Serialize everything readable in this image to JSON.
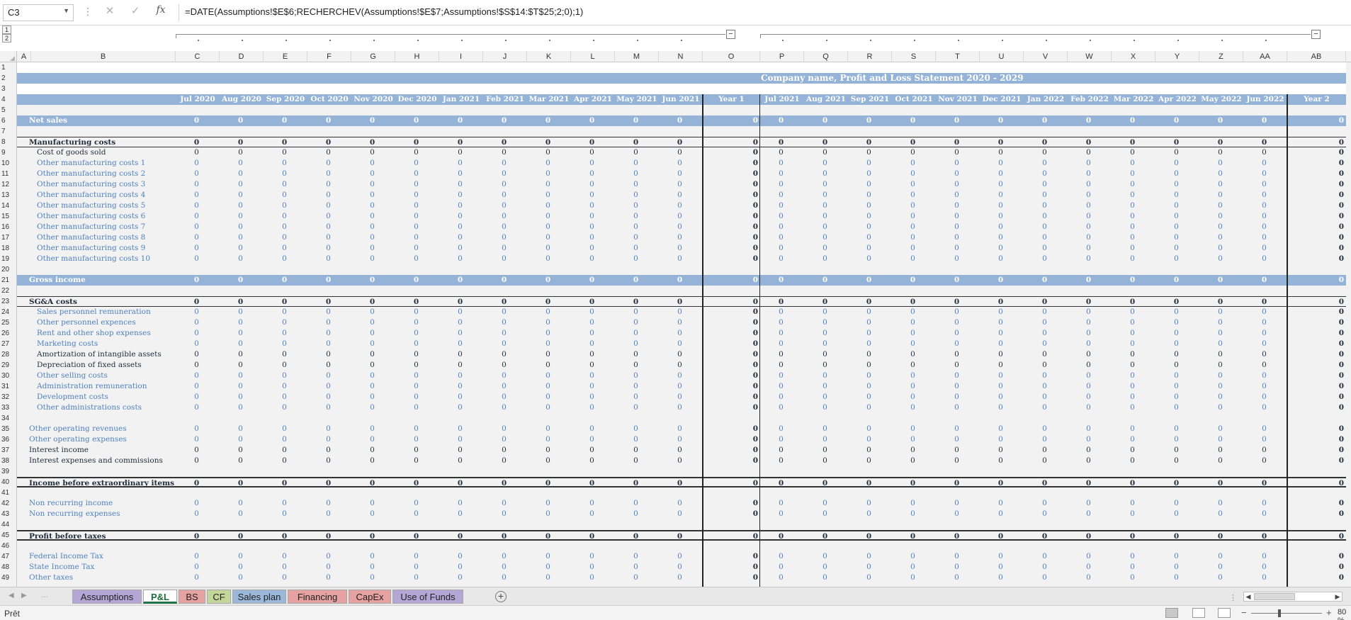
{
  "formula_bar": {
    "name_box": "C3",
    "formula": "=DATE(Assumptions!$E$6;RECHERCHEV(Assumptions!$E$7;Assumptions!$S$14:$T$25;2;0);1)"
  },
  "outline": {
    "levels": [
      "1",
      "2"
    ],
    "collapse_symbol": "−"
  },
  "columns": [
    "A",
    "B",
    "C",
    "D",
    "E",
    "F",
    "G",
    "H",
    "I",
    "J",
    "K",
    "L",
    "M",
    "N",
    "O",
    "P",
    "Q",
    "R",
    "S",
    "T",
    "U",
    "V",
    "W",
    "X",
    "Y",
    "Z",
    "AA",
    "AB"
  ],
  "sheet": {
    "title": "Company name, Profit and Loss Statement 2020 - 2029",
    "months_year1": [
      "Jul 2020",
      "Aug 2020",
      "Sep 2020",
      "Oct 2020",
      "Nov 2020",
      "Dec 2020",
      "Jan 2021",
      "Feb 2021",
      "Mar 2021",
      "Apr 2021",
      "May 2021",
      "Jun 2021"
    ],
    "year1_label": "Year 1",
    "months_year2": [
      "Jul 2021",
      "Aug 2021",
      "Sep 2021",
      "Oct 2021",
      "Nov 2021",
      "Dec 2021",
      "Jan 2022",
      "Feb 2022",
      "Mar 2022",
      "Apr 2022",
      "May 2022",
      "Jun 2022"
    ],
    "year2_label": "Year 2",
    "zero": "0",
    "rows": [
      {
        "n": "1",
        "type": "blank"
      },
      {
        "n": "2",
        "type": "title"
      },
      {
        "n": "3",
        "type": "blank"
      },
      {
        "n": "4",
        "type": "header"
      },
      {
        "n": "5",
        "type": "blank"
      },
      {
        "n": "6",
        "type": "band",
        "label": "Net sales"
      },
      {
        "n": "7",
        "type": "blank"
      },
      {
        "n": "8",
        "type": "section",
        "label": "Manufacturing costs"
      },
      {
        "n": "9",
        "type": "item",
        "style": "dark",
        "indent": true,
        "label": "Cost of goods sold"
      },
      {
        "n": "10",
        "type": "item",
        "style": "blue",
        "indent": true,
        "label": "Other manufacturing costs 1"
      },
      {
        "n": "11",
        "type": "item",
        "style": "blue",
        "indent": true,
        "label": "Other manufacturing costs 2"
      },
      {
        "n": "12",
        "type": "item",
        "style": "blue",
        "indent": true,
        "label": "Other manufacturing costs 3"
      },
      {
        "n": "13",
        "type": "item",
        "style": "blue",
        "indent": true,
        "label": "Other manufacturing costs 4"
      },
      {
        "n": "14",
        "type": "item",
        "style": "blue",
        "indent": true,
        "label": "Other manufacturing costs 5"
      },
      {
        "n": "15",
        "type": "item",
        "style": "blue",
        "indent": true,
        "label": "Other manufacturing costs 6"
      },
      {
        "n": "16",
        "type": "item",
        "style": "blue",
        "indent": true,
        "label": "Other manufacturing costs 7"
      },
      {
        "n": "17",
        "type": "item",
        "style": "blue",
        "indent": true,
        "label": "Other manufacturing costs 8"
      },
      {
        "n": "18",
        "type": "item",
        "style": "blue",
        "indent": true,
        "label": "Other manufacturing costs 9"
      },
      {
        "n": "19",
        "type": "item",
        "style": "blue",
        "indent": true,
        "label": "Other manufacturing costs 10"
      },
      {
        "n": "20",
        "type": "blank"
      },
      {
        "n": "21",
        "type": "band",
        "label": "Gross income"
      },
      {
        "n": "22",
        "type": "blank"
      },
      {
        "n": "23",
        "type": "section",
        "label": "SG&A costs"
      },
      {
        "n": "24",
        "type": "item",
        "style": "blue",
        "indent": true,
        "label": "Sales personnel remuneration"
      },
      {
        "n": "25",
        "type": "item",
        "style": "blue",
        "indent": true,
        "label": "Other personnel expences"
      },
      {
        "n": "26",
        "type": "item",
        "style": "blue",
        "indent": true,
        "label": "Rent and other shop expenses"
      },
      {
        "n": "27",
        "type": "item",
        "style": "blue",
        "indent": true,
        "label": "Marketing costs"
      },
      {
        "n": "28",
        "type": "item",
        "style": "dark",
        "indent": true,
        "label": "Amortization of intangible assets"
      },
      {
        "n": "29",
        "type": "item",
        "style": "dark",
        "indent": true,
        "label": "Depreciation of fixed assets"
      },
      {
        "n": "30",
        "type": "item",
        "style": "blue",
        "indent": true,
        "label": "Other selling costs"
      },
      {
        "n": "31",
        "type": "item",
        "style": "blue",
        "indent": true,
        "label": "Administration remuneration"
      },
      {
        "n": "32",
        "type": "item",
        "style": "blue",
        "indent": true,
        "label": "Development costs"
      },
      {
        "n": "33",
        "type": "item",
        "style": "blue",
        "indent": true,
        "label": "Other administrations costs"
      },
      {
        "n": "34",
        "type": "blank"
      },
      {
        "n": "35",
        "type": "item",
        "style": "blue",
        "indent": false,
        "label": "Other operating revenues"
      },
      {
        "n": "36",
        "type": "item",
        "style": "blue",
        "indent": false,
        "label": "Other operating expenses"
      },
      {
        "n": "37",
        "type": "item",
        "style": "dark",
        "indent": false,
        "label": "Interest income"
      },
      {
        "n": "38",
        "type": "item",
        "style": "dark",
        "indent": false,
        "label": "Interest expenses and commissions"
      },
      {
        "n": "39",
        "type": "blank"
      },
      {
        "n": "40",
        "type": "section2",
        "label": "Income before extraordinary items"
      },
      {
        "n": "41",
        "type": "blank"
      },
      {
        "n": "42",
        "type": "item",
        "style": "blue",
        "indent": false,
        "label": "Non recurring income"
      },
      {
        "n": "43",
        "type": "item",
        "style": "blue",
        "indent": false,
        "label": "Non recurring expenses"
      },
      {
        "n": "44",
        "type": "blank"
      },
      {
        "n": "45",
        "type": "section2",
        "label": "Profit before taxes"
      },
      {
        "n": "46",
        "type": "blank"
      },
      {
        "n": "47",
        "type": "item",
        "style": "blue",
        "indent": false,
        "label": "Federal Income Tax"
      },
      {
        "n": "48",
        "type": "item",
        "style": "blue",
        "indent": false,
        "label": "State Income Tax"
      },
      {
        "n": "49",
        "type": "item",
        "style": "blue",
        "indent": false,
        "label": "Other taxes"
      }
    ]
  },
  "tabs": [
    {
      "label": "Assumptions",
      "color": "#b4a7d6"
    },
    {
      "label": "P&L",
      "color": "#ffffff",
      "active": true
    },
    {
      "label": "BS",
      "color": "#e6a1a1"
    },
    {
      "label": "CF",
      "color": "#c4d79b"
    },
    {
      "label": "Sales plan",
      "color": "#9bb8da"
    },
    {
      "label": "Financing",
      "color": "#e6a1a1"
    },
    {
      "label": "CapEx",
      "color": "#e6a1a1"
    },
    {
      "label": "Use of Funds",
      "color": "#b4a7d6"
    }
  ],
  "status": {
    "text": "Prêt",
    "zoom": "80 %"
  },
  "colors": {
    "band": "#95b3d7",
    "blue_text": "#4f81bd",
    "dark_text": "#1f2d3d",
    "sheet_bg": "#f2f2f2",
    "grid_line": "#e2e2e2"
  }
}
